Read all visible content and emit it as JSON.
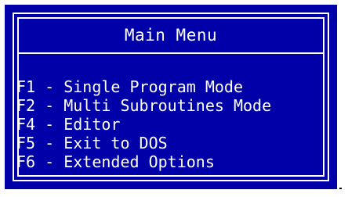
{
  "window": {
    "title": "Main Menu",
    "background_color": "#0000a8",
    "text_color": "#ffffff"
  },
  "menu": {
    "separator": " - ",
    "items": [
      {
        "key": "F1",
        "label": "Single Program Mode"
      },
      {
        "key": "F2",
        "label": "Multi Subroutines Mode"
      },
      {
        "key": "F4",
        "label": "Editor"
      },
      {
        "key": "F5",
        "label": "Exit to DOS"
      },
      {
        "key": "F6",
        "label": "Extended Options"
      }
    ]
  }
}
